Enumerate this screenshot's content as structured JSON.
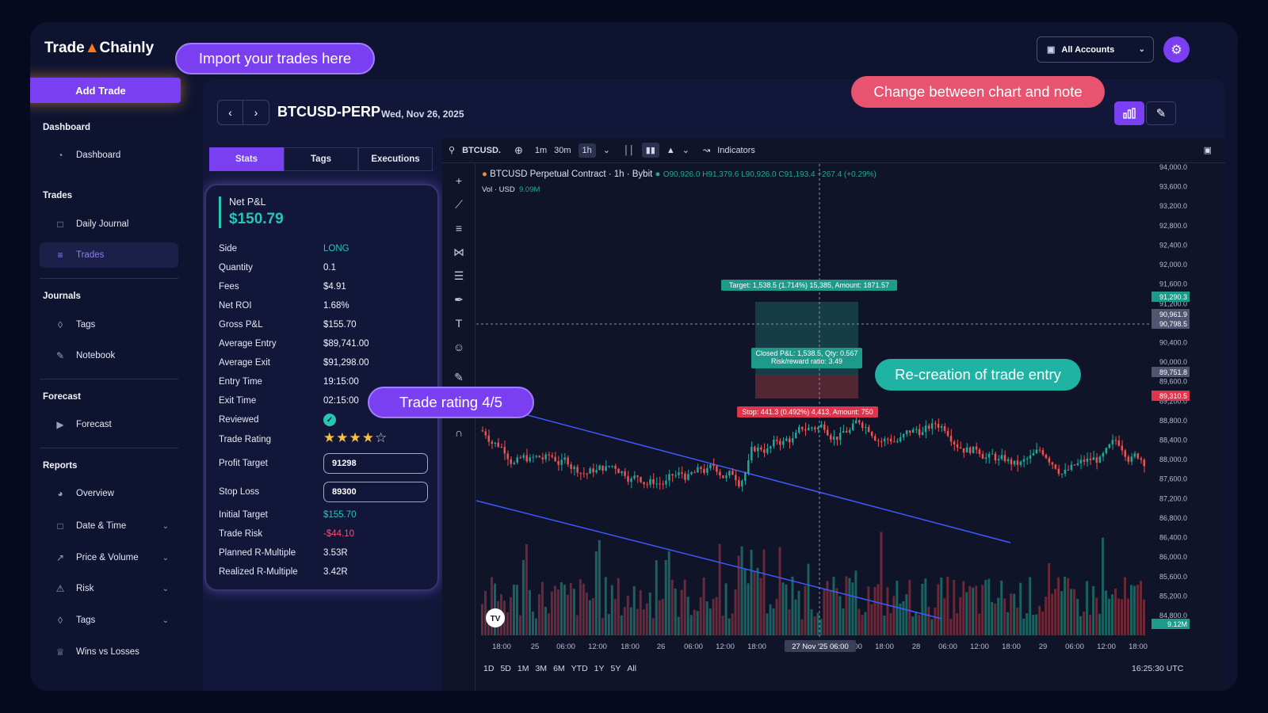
{
  "app": {
    "logo_text_left": "Trade",
    "logo_text_right": "Chainly"
  },
  "sidebar": {
    "add_trade": "Add Trade",
    "sections": [
      {
        "title": "Dashboard",
        "items": [
          {
            "label": "Dashboard",
            "icon": "gauge-icon"
          }
        ]
      },
      {
        "title": "Trades",
        "items": [
          {
            "label": "Daily Journal",
            "icon": "calendar-icon"
          },
          {
            "label": "Trades",
            "icon": "sliders-icon",
            "active": true
          }
        ]
      },
      {
        "title": "Journals",
        "items": [
          {
            "label": "Tags",
            "icon": "tag-icon"
          },
          {
            "label": "Notebook",
            "icon": "pencil-icon"
          }
        ]
      },
      {
        "title": "Forecast",
        "items": [
          {
            "label": "Forecast",
            "icon": "megaphone-icon"
          }
        ]
      },
      {
        "title": "Reports",
        "items": [
          {
            "label": "Overview",
            "icon": "pie-icon"
          },
          {
            "label": "Date & Time",
            "icon": "calendar-clock-icon",
            "expandable": true
          },
          {
            "label": "Price & Volume",
            "icon": "trend-icon",
            "expandable": true
          },
          {
            "label": "Risk",
            "icon": "risk-icon",
            "expandable": true
          },
          {
            "label": "Tags",
            "icon": "tag-icon",
            "expandable": true
          },
          {
            "label": "Wins vs Losses",
            "icon": "trophy-icon"
          }
        ]
      }
    ]
  },
  "topbar": {
    "account_select": "All Accounts"
  },
  "trade_header": {
    "symbol": "BTCUSD-PERP",
    "date": "Wed, Nov 26, 2025"
  },
  "tabs": [
    {
      "label": "Stats",
      "active": true
    },
    {
      "label": "Tags"
    },
    {
      "label": "Executions"
    }
  ],
  "stats": {
    "net_pnl_label": "Net P&L",
    "net_pnl_value": "$150.79",
    "rows": [
      {
        "label": "Side",
        "value": "LONG",
        "color": "green"
      },
      {
        "label": "Quantity",
        "value": "0.1"
      },
      {
        "label": "Fees",
        "value": "$4.91"
      },
      {
        "label": "Net ROI",
        "value": "1.68%"
      },
      {
        "label": "Gross P&L",
        "value": "$155.70"
      },
      {
        "label": "Average Entry",
        "value": "$89,741.00"
      },
      {
        "label": "Average Exit",
        "value": "$91,298.00"
      },
      {
        "label": "Entry Time",
        "value": "19:15:00"
      },
      {
        "label": "Exit Time",
        "value": "02:15:00"
      }
    ],
    "reviewed_label": "Reviewed",
    "rating_label": "Trade Rating",
    "rating": 4,
    "rating_max": 5,
    "profit_target_label": "Profit Target",
    "profit_target_value": "91298",
    "stop_loss_label": "Stop Loss",
    "stop_loss_value": "89300",
    "rows2": [
      {
        "label": "Initial Target",
        "value": "$155.70",
        "color": "green"
      },
      {
        "label": "Trade Risk",
        "value": "-$44.10",
        "color": "red"
      },
      {
        "label": "Planned R-Multiple",
        "value": "3.53R"
      },
      {
        "label": "Realized R-Multiple",
        "value": "3.42R"
      }
    ]
  },
  "chart": {
    "search_symbol": "BTCUSD.",
    "timeframes": [
      "1m",
      "30m",
      "1h"
    ],
    "active_timeframe": "1h",
    "indicators_label": "Indicators",
    "legend_title": "BTCUSD Perpetual Contract · 1h · Bybit",
    "legend_ohlc": "O90,926.0 H91,379.6 L90,926.0 C91,193.4 +267.4 (+0.29%)",
    "vol_label": "Vol · USD",
    "vol_value": "9.09M",
    "target_label": "Target: 1,538.5 (1.714%) 15,385, Amount: 1871.57",
    "closed_label_1": "Closed P&L: 1,538.5, Qty: 0.567",
    "closed_label_2": "Risk/reward ratio: 3.49",
    "stop_label": "Stop: 441.3 (0.492%) 4,413, Amount: 750",
    "y_ticks": [
      "94,000.0",
      "93,600.0",
      "93,200.0",
      "92,800.0",
      "92,400.0",
      "92,000.0",
      "91,600.0",
      "91,200.0",
      "90,800.0",
      "90,400.0",
      "90,000.0",
      "89,600.0",
      "89,200.0",
      "88,800.0",
      "88,400.0",
      "88,000.0",
      "87,600.0",
      "87,200.0",
      "86,800.0",
      "86,400.0",
      "86,000.0",
      "85,600.0",
      "85,200.0",
      "84,800.0"
    ],
    "price_badges": [
      {
        "value": "91,290.3",
        "kind": "green"
      },
      {
        "value": "90,961.9",
        "kind": "grey"
      },
      {
        "value": "90,798.5",
        "kind": "grey"
      },
      {
        "value": "89,751.8",
        "kind": "grey"
      },
      {
        "value": "89,310.5",
        "kind": "red"
      },
      {
        "value": "9.12M",
        "kind": "green"
      }
    ],
    "x_ticks": [
      "18:00",
      "25",
      "06:00",
      "12:00",
      "18:00",
      "26",
      "06:00",
      "12:00",
      "18:00",
      "27 Nov '25",
      "06:00",
      "12:00",
      "18:00",
      "28",
      "06:00",
      "12:00",
      "18:00",
      "29",
      "06:00",
      "12:00",
      "18:00"
    ],
    "crosshair_label": "27 Nov '25  06:00",
    "ranges": [
      "1D",
      "5D",
      "1M",
      "3M",
      "6M",
      "YTD",
      "1Y",
      "5Y",
      "All"
    ],
    "utc_time": "16:25:30 UTC",
    "tv_badge": "TV"
  },
  "callouts": {
    "import": "Import your trades here",
    "change": "Change between chart and note",
    "recreation": "Re-creation of trade entry",
    "rating": "Trade rating 4/5"
  },
  "colors": {
    "accent": "#7b3ff2",
    "up": "#26a69a",
    "down": "#ef5350",
    "pnl": "#26c6b3"
  }
}
